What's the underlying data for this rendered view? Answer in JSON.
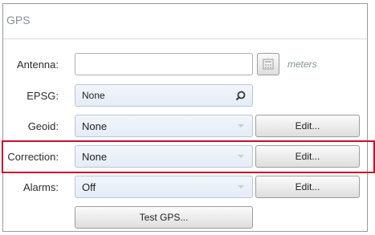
{
  "panel": {
    "title": "GPS"
  },
  "antenna": {
    "label": "Antenna:",
    "value": "",
    "unit": "meters",
    "icon": "calculator-icon"
  },
  "epsg": {
    "label": "EPSG:",
    "value": "None",
    "icon": "search-icon"
  },
  "geoid": {
    "label": "Geoid:",
    "value": "None",
    "edit_label": "Edit..."
  },
  "correction": {
    "label": "Correction:",
    "value": "None",
    "edit_label": "Edit..."
  },
  "alarms": {
    "label": "Alarms:",
    "value": "Off",
    "edit_label": "Edit..."
  },
  "test_button": {
    "label": "Test GPS..."
  },
  "colors": {
    "highlight": "#c8102e",
    "field_bg": "#e9f0f8",
    "button_bg": "#eeeeee"
  }
}
